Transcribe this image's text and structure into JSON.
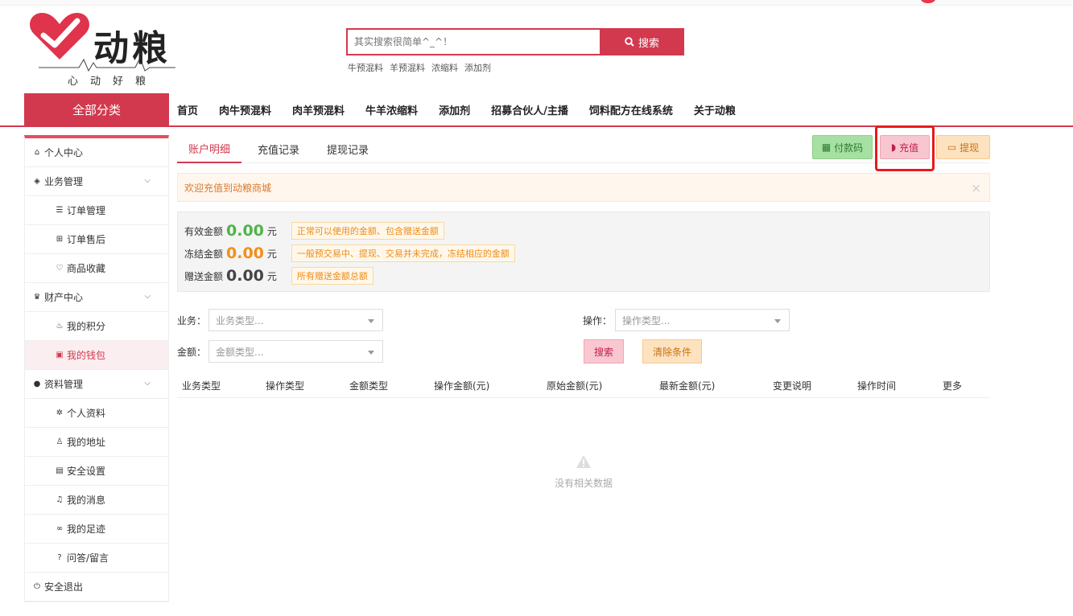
{
  "brand": {
    "name": "动粮",
    "slogan": "心动好粮",
    "accent_color": "#d3394e"
  },
  "search": {
    "placeholder": "其实搜索很简单^_^！",
    "button_label": "搜索",
    "hot_keywords": [
      "牛预混料",
      "羊预混料",
      "浓缩料",
      "添加剂"
    ]
  },
  "nav": {
    "category_label": "全部分类",
    "items": [
      "首页",
      "肉牛预混料",
      "肉羊预混料",
      "牛羊浓缩料",
      "添加剂",
      "招募合伙人/主播",
      "饲料配方在线系统",
      "关于动粮"
    ]
  },
  "sidebar": {
    "items": [
      {
        "label": "个人中心",
        "icon": "home-icon",
        "level": 0
      },
      {
        "label": "业务管理",
        "icon": "cube-icon",
        "level": 0,
        "expandable": true
      },
      {
        "label": "订单管理",
        "icon": "list-icon",
        "level": 1
      },
      {
        "label": "订单售后",
        "icon": "puzzle-icon",
        "level": 1
      },
      {
        "label": "商品收藏",
        "icon": "heart-icon",
        "level": 1
      },
      {
        "label": "财产中心",
        "icon": "trophy-icon",
        "level": 0,
        "expandable": true
      },
      {
        "label": "我的积分",
        "icon": "fire-icon",
        "level": 1
      },
      {
        "label": "我的钱包",
        "icon": "wallet-icon",
        "level": 1,
        "active": true
      },
      {
        "label": "资料管理",
        "icon": "user-icon",
        "level": 0,
        "expandable": true
      },
      {
        "label": "个人资料",
        "icon": "gear-icon",
        "level": 1
      },
      {
        "label": "我的地址",
        "icon": "mic-icon",
        "level": 1
      },
      {
        "label": "安全设置",
        "icon": "lock-icon",
        "level": 1
      },
      {
        "label": "我的消息",
        "icon": "bell-icon",
        "level": 1
      },
      {
        "label": "我的足迹",
        "icon": "footprint-icon",
        "level": 1
      },
      {
        "label": "问答/留言",
        "icon": "question-icon",
        "level": 1
      },
      {
        "label": "安全退出",
        "icon": "power-icon",
        "level": 0
      }
    ]
  },
  "tabs": [
    "账户明细",
    "充值记录",
    "提现记录"
  ],
  "actions": {
    "pay_code": "付款码",
    "recharge": "充值",
    "withdraw": "提现"
  },
  "notice": {
    "text": "欢迎充值到动粮商城",
    "close": "×"
  },
  "balance": {
    "rows": [
      {
        "label": "有效金额",
        "value": "0.00",
        "unit": "元",
        "tip": "正常可以使用的金额、包含赠送金额"
      },
      {
        "label": "冻结金额",
        "value": "0.00",
        "unit": "元",
        "tip": "一般预交易中、提现、交易并未完成，冻结相应的金额"
      },
      {
        "label": "赠送金额",
        "value": "0.00",
        "unit": "元",
        "tip": "所有赠送金额总额"
      }
    ]
  },
  "filters": {
    "business_label": "业务：",
    "business_placeholder": "业务类型...",
    "operation_label": "操作：",
    "operation_placeholder": "操作类型...",
    "amount_label": "金额：",
    "amount_placeholder": "金额类型...",
    "search_button": "搜索",
    "clear_button": "清除条件"
  },
  "table": {
    "columns": [
      "业务类型",
      "操作类型",
      "金额类型",
      "操作金额(元)",
      "原始金额(元)",
      "最新金额(元)",
      "变更说明",
      "操作时间",
      "更多"
    ],
    "empty_text": "没有相关数据"
  }
}
